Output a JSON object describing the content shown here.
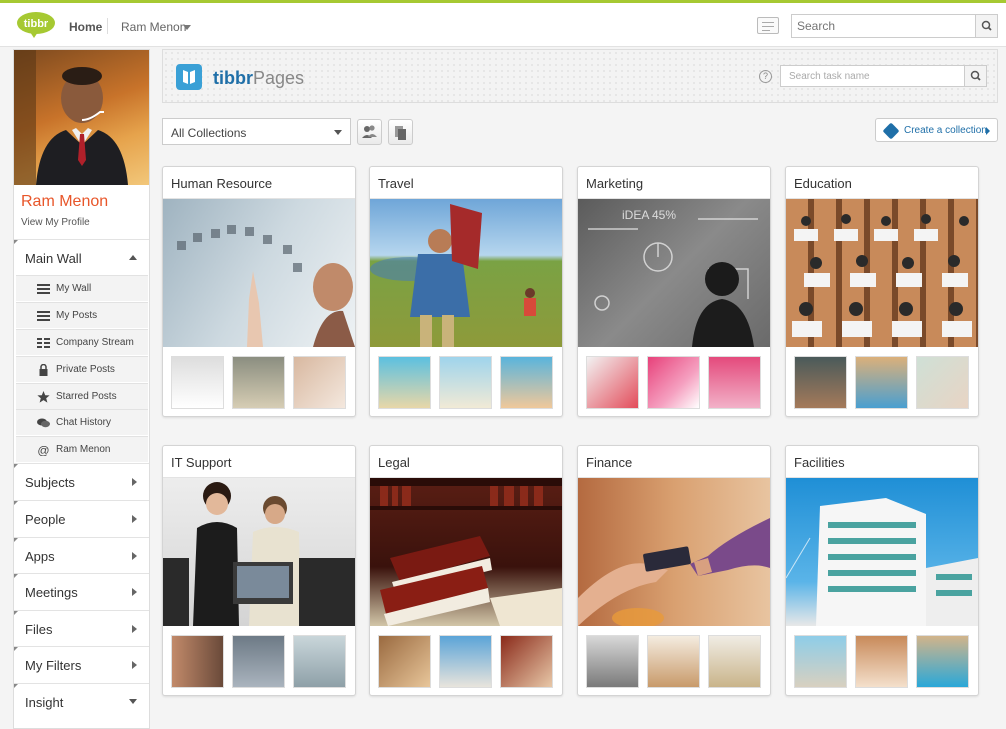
{
  "topbar": {
    "logo_text": "tibbr",
    "home": "Home",
    "user": "Ram Menon",
    "search_placeholder": "Search"
  },
  "profile": {
    "name": "Ram Menon",
    "link": "View My Profile"
  },
  "sidebar": {
    "main_wall": "Main Wall",
    "sub_items": [
      {
        "label": "My Wall",
        "icon": "list-icon"
      },
      {
        "label": "My Posts",
        "icon": "list-icon"
      },
      {
        "label": "Company Stream",
        "icon": "grid-icon"
      },
      {
        "label": "Private Posts",
        "icon": "lock-icon"
      },
      {
        "label": "Starred Posts",
        "icon": "star-icon"
      },
      {
        "label": "Chat History",
        "icon": "chat-icon"
      },
      {
        "label": "Ram Menon",
        "icon": "at-icon"
      }
    ],
    "sections": [
      "Subjects",
      "People",
      "Apps",
      "Meetings",
      "Files",
      "My Filters",
      "Insight"
    ]
  },
  "pages_header": {
    "brand": "tibbr",
    "title": "Pages",
    "task_search_placeholder": "Search task name"
  },
  "toolbar": {
    "collections_select": "All Collections",
    "create_collection": "Create a collection"
  },
  "collections": [
    {
      "title": "Human Resource"
    },
    {
      "title": "Travel"
    },
    {
      "title": "Marketing"
    },
    {
      "title": "Education"
    },
    {
      "title": "IT Support"
    },
    {
      "title": "Legal"
    },
    {
      "title": "Finance"
    },
    {
      "title": "Facilities"
    }
  ],
  "colors": {
    "accent_green": "#a6c932",
    "brand_blue": "#1f6fa8",
    "name_orange": "#e8562a"
  }
}
